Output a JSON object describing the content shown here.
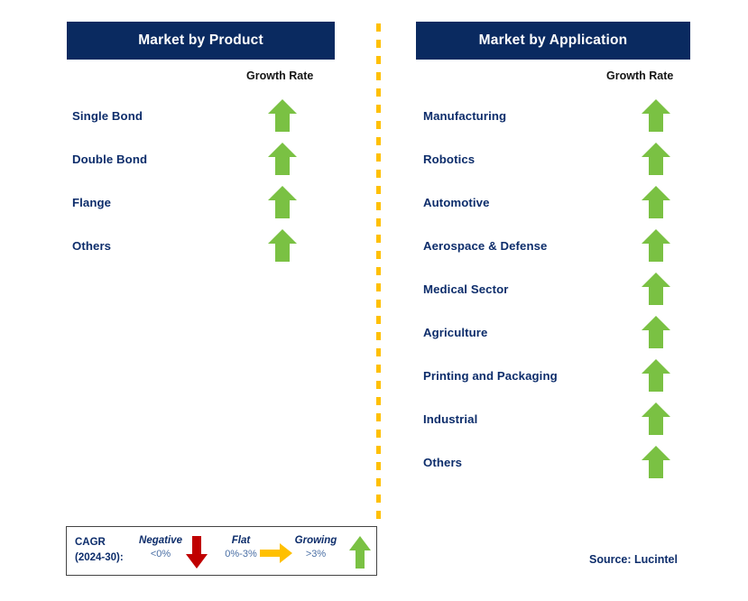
{
  "columns": [
    {
      "id": "product",
      "title": "Market by Product",
      "growth_caption": "Growth Rate",
      "items": [
        {
          "label": "Single Bond",
          "trend": "growing"
        },
        {
          "label": "Double Bond",
          "trend": "growing"
        },
        {
          "label": "Flange",
          "trend": "growing"
        },
        {
          "label": "Others",
          "trend": "growing"
        }
      ]
    },
    {
      "id": "application",
      "title": "Market by Application",
      "growth_caption": "Growth Rate",
      "items": [
        {
          "label": "Manufacturing",
          "trend": "growing"
        },
        {
          "label": "Robotics",
          "trend": "growing"
        },
        {
          "label": "Automotive",
          "trend": "growing"
        },
        {
          "label": "Aerospace & Defense",
          "trend": "growing"
        },
        {
          "label": "Medical Sector",
          "trend": "growing"
        },
        {
          "label": "Agriculture",
          "trend": "growing"
        },
        {
          "label": "Printing and Packaging",
          "trend": "growing"
        },
        {
          "label": "Industrial",
          "trend": "growing"
        },
        {
          "label": "Others",
          "trend": "growing"
        }
      ]
    }
  ],
  "legend": {
    "cagr_line1": "CAGR",
    "cagr_line2": "(2024-30):",
    "entries": [
      {
        "title": "Negative",
        "value": "<0%",
        "icon": "arrow-down-icon",
        "color": "#c00000"
      },
      {
        "title": "Flat",
        "value": "0%-3%",
        "icon": "arrow-right-icon",
        "color": "#ffc000"
      },
      {
        "title": "Growing",
        "value": ">3%",
        "icon": "arrow-up-icon",
        "color": "#7ac143"
      }
    ]
  },
  "source": "Source: Lucintel",
  "colors": {
    "header_navy": "#0a2a60",
    "label_navy": "#0d2d6b",
    "growing_green": "#7ac143",
    "negative_red": "#c00000",
    "flat_yellow": "#ffc000",
    "divider_orange": "#ffc000"
  }
}
